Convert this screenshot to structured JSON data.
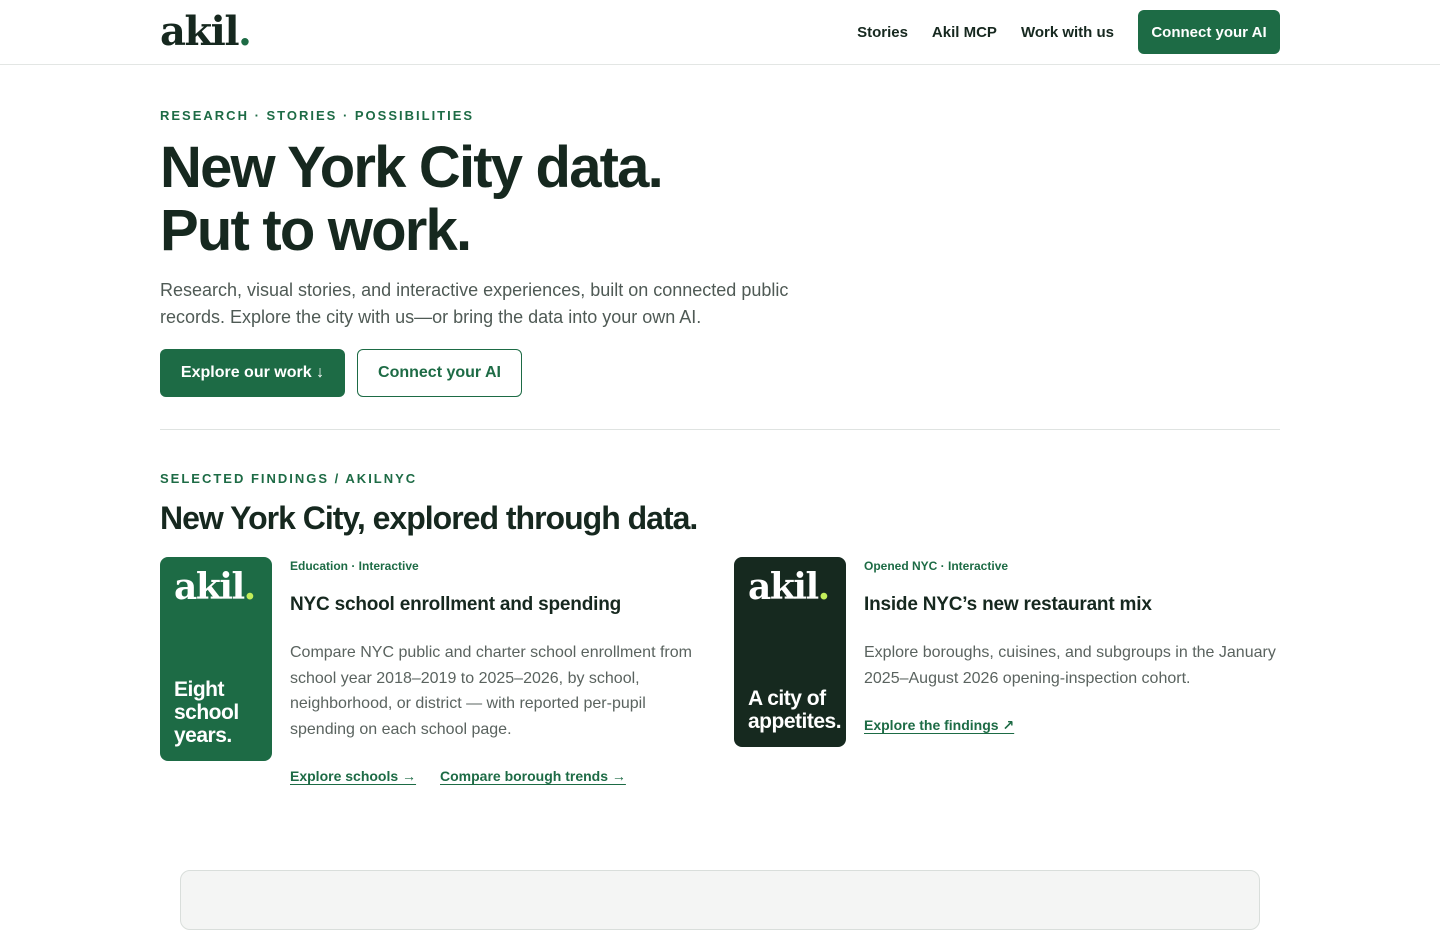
{
  "header": {
    "logo_text": "akil",
    "logo_dot": ".",
    "nav": [
      "Stories",
      "Akil MCP",
      "Work with us"
    ],
    "cta": "Connect your AI"
  },
  "hero": {
    "eyebrow": "RESEARCH · STORIES · POSSIBILITIES",
    "title_line1": "New York City data.",
    "title_line2": "Put to work.",
    "subtitle": "Research, visual stories, and interactive experiences, built on connected public records. Explore the city with us—or bring the data into your own AI.",
    "primary_button": "Explore our work ↓",
    "secondary_button": "Connect your AI"
  },
  "findings": {
    "eyebrow": "SELECTED FINDINGS / AKILNYC",
    "title": "New York City, explored through data.",
    "cards": [
      {
        "thumb_logo": "akil",
        "thumb_dot": ".",
        "thumb_text": "Eight school years.",
        "meta": "Education · Interactive",
        "title": "NYC school enrollment and spending",
        "description": "Compare NYC public and charter school enrollment from school year 2018–2019 to 2025–2026, by school, neighborhood, or district — with reported per-pupil spending on each school page.",
        "links": [
          "Explore schools →",
          "Compare borough trends →"
        ]
      },
      {
        "thumb_logo": "akil",
        "thumb_dot": ".",
        "thumb_text": "A city of appetites.",
        "meta": "Opened NYC · Interactive",
        "title": "Inside NYC’s new restaurant mix",
        "description": "Explore boroughs, cuisines, and subgroups in the January 2025–August 2026 opening-inspection cohort.",
        "links": [
          "Explore the findings ↗"
        ]
      }
    ]
  },
  "colors": {
    "accent": "#1d6b45",
    "dark": "#16281f",
    "lime": "#c3ee5a"
  }
}
